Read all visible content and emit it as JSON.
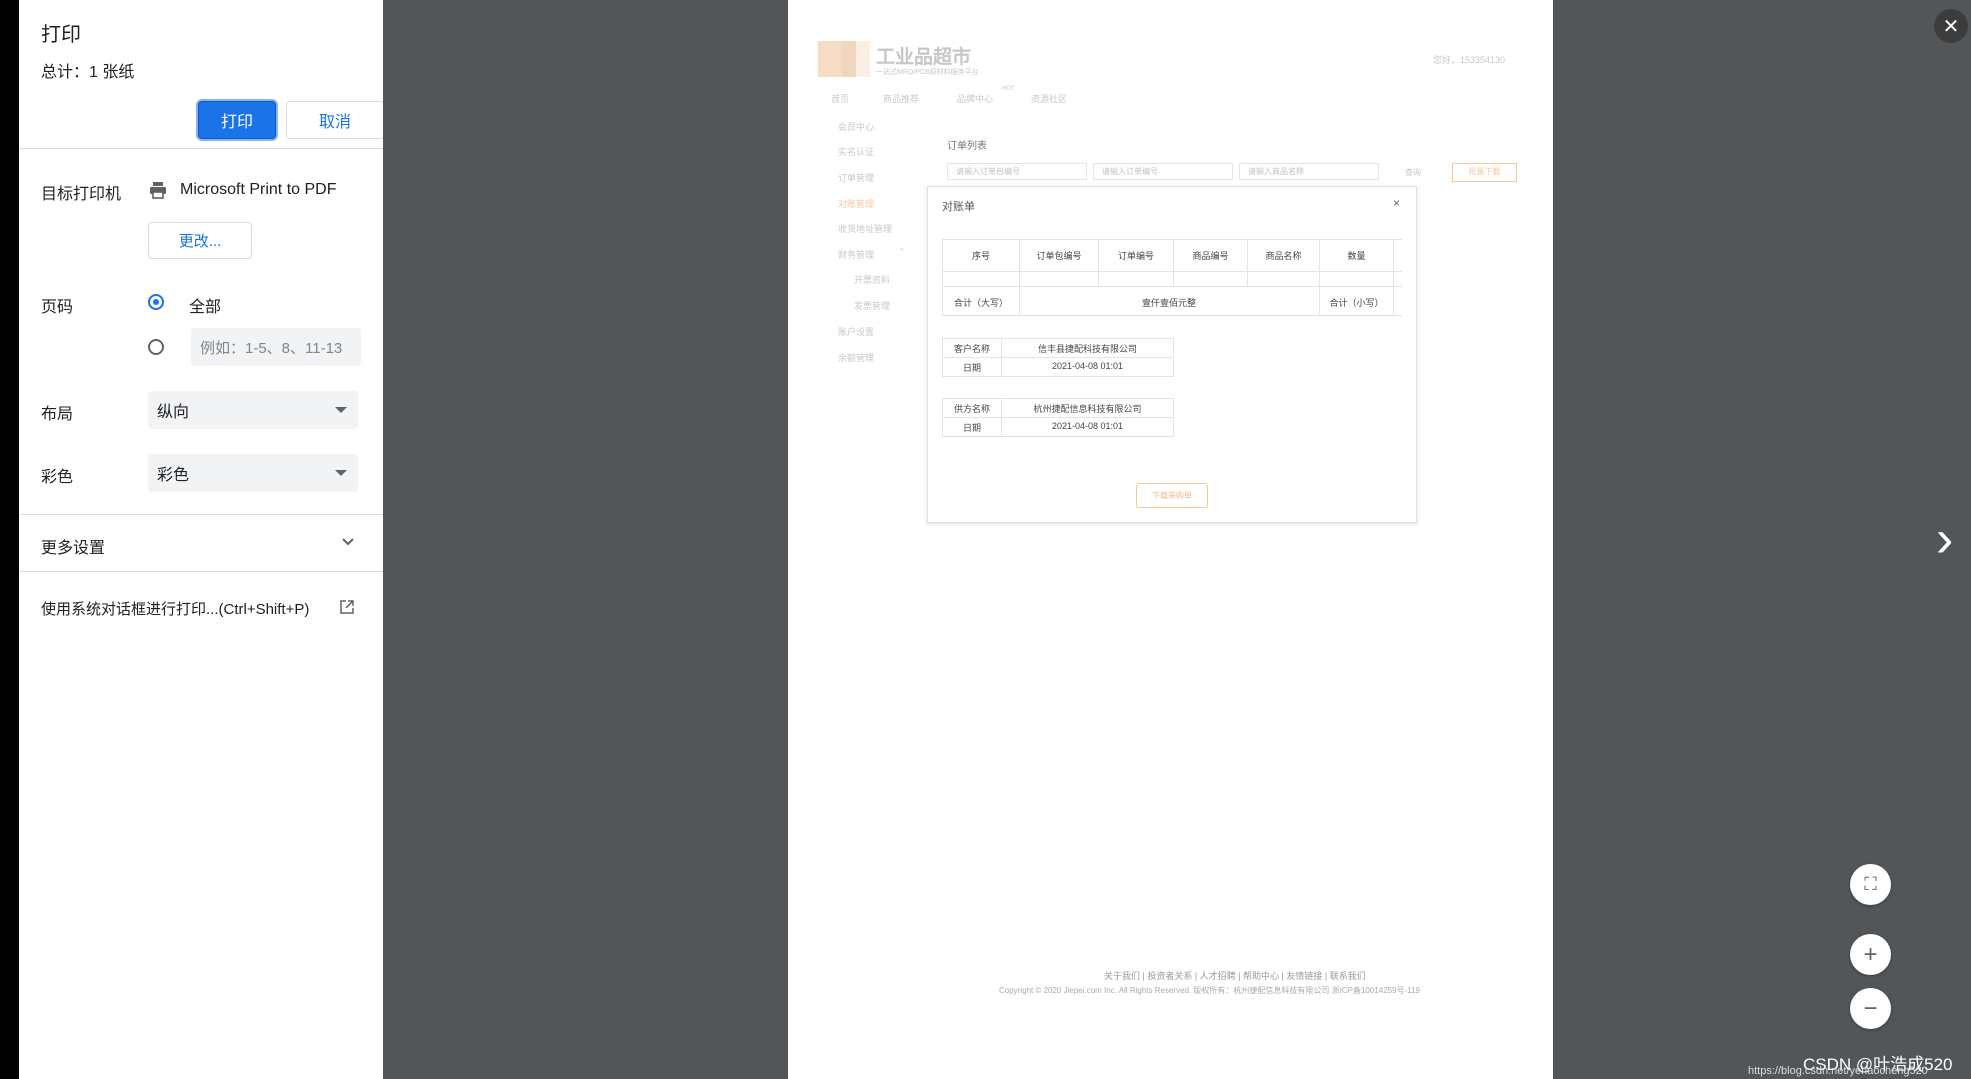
{
  "print_dialog": {
    "title": "打印",
    "total": "总计：1 张纸",
    "print_button": "打印",
    "cancel_button": "取消",
    "destination_label": "目标打印机",
    "destination_value": "Microsoft Print to PDF",
    "change_button": "更改...",
    "pages_label": "页码",
    "pages_all": "全部",
    "pages_custom_placeholder": "例如：1-5、8、11-13",
    "layout_label": "布局",
    "layout_value": "纵向",
    "color_label": "彩色",
    "color_value": "彩色",
    "more_settings": "更多设置",
    "system_dialog": "使用系统对话框进行打印...(Ctrl+Shift+P)"
  },
  "preview_page": {
    "logo_text": "工业品超市",
    "logo_sub": "一站式MRO/PCB原材料服务平台",
    "greeting": "您好，153354130",
    "nav": [
      "首页",
      "商品推荐",
      "品牌中心",
      "资源社区"
    ],
    "nav_badge": "HOT",
    "sidebar": [
      "会员中心",
      "实名认证",
      "订单管理",
      "对账管理",
      "收货地址管理",
      "财务管理",
      "开票资料",
      "发票管理",
      "账户设置",
      "余额管理"
    ],
    "order_list_title": "订单列表",
    "search_inputs": [
      "请输入订单包编号",
      "请输入订单编号",
      "请输入商品名称"
    ],
    "search_btn": "查询",
    "batch_btn": "批量下载",
    "modal": {
      "title": "对账单",
      "close": "×",
      "columns": [
        "序号",
        "订单包编号",
        "订单编号",
        "商品编号",
        "商品名称",
        "数量"
      ],
      "total_upper_label": "合计（大写）",
      "total_upper_value": "壹仟壹佰元整",
      "total_lower_label": "合计（小写）",
      "customer_label": "客户名称",
      "customer_value": "信丰县捷配科技有限公司",
      "date_label": "日期",
      "date_value_1": "2021-04-08 01:01",
      "supplier_label": "供方名称",
      "supplier_value": "杭州捷配信息科技有限公司",
      "date_value_2": "2021-04-08 01:01",
      "download_btn": "下载采购单"
    },
    "footer_links": "关于我们 | 投资者关系 | 人才招聘 | 帮助中心 | 友情链接 | 联系我们",
    "footer_copyright": "Copyright © 2020 Jiepei.com Inc. All Rights Reserved. 版权所有：杭州捷配信息科技有限公司 浙ICP备10014259号-119"
  },
  "viewer": {
    "close": "✕",
    "next": "›",
    "fit": "⛶",
    "zoom_in": "+",
    "zoom_out": "−"
  },
  "watermark": {
    "csdn": "CSDN @叶浩成520",
    "url": "https://blog.csdn.net/yehaocheng520"
  }
}
